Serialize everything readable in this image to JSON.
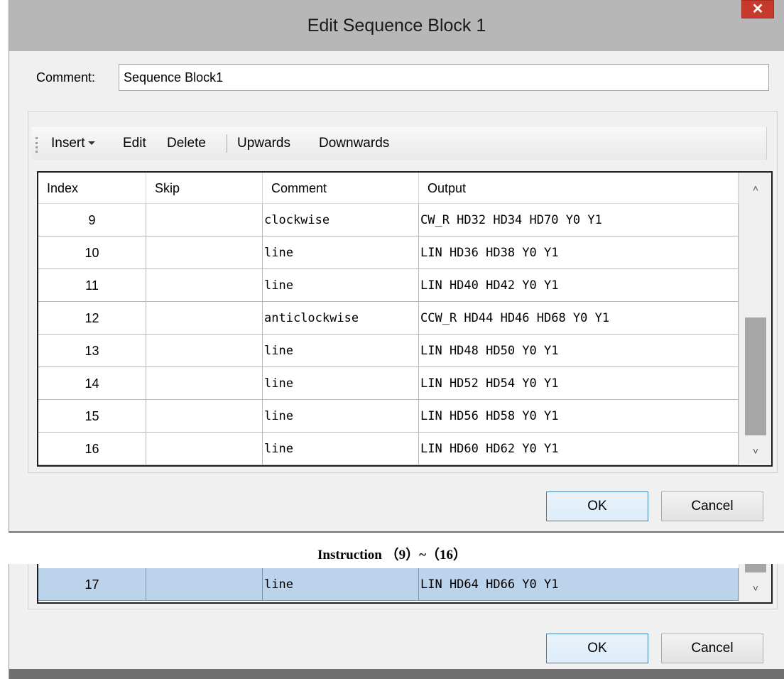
{
  "dialog": {
    "title": "Edit Sequence Block 1",
    "close_label": "✕",
    "comment_label": "Comment:",
    "comment_value": "Sequence Block1"
  },
  "toolbar": {
    "insert": "Insert",
    "edit": "Edit",
    "delete": "Delete",
    "upwards": "Upwards",
    "downwards": "Downwards"
  },
  "table": {
    "headers": [
      "Index",
      "Skip",
      "Comment",
      "Output"
    ],
    "rows": [
      {
        "index": "9",
        "skip": "",
        "comment": "clockwise",
        "output": "CW_R HD32 HD34 HD70 Y0 Y1"
      },
      {
        "index": "10",
        "skip": "",
        "comment": "line",
        "output": "LIN HD36 HD38 Y0 Y1"
      },
      {
        "index": "11",
        "skip": "",
        "comment": "line",
        "output": "LIN HD40 HD42 Y0 Y1"
      },
      {
        "index": "12",
        "skip": "",
        "comment": "anticlockwise",
        "output": "CCW_R HD44 HD46 HD68 Y0 Y1"
      },
      {
        "index": "13",
        "skip": "",
        "comment": "line",
        "output": "LIN HD48 HD50 Y0 Y1"
      },
      {
        "index": "14",
        "skip": "",
        "comment": "line",
        "output": "LIN HD52 HD54 Y0 Y1"
      },
      {
        "index": "15",
        "skip": "",
        "comment": "line",
        "output": "LIN HD56 HD58 Y0 Y1"
      },
      {
        "index": "16",
        "skip": "",
        "comment": "line",
        "output": "LIN HD60 HD62 Y0 Y1"
      }
    ]
  },
  "buttons": {
    "ok": "OK",
    "cancel": "Cancel"
  },
  "caption": "Instruction （9）~（16）",
  "second": {
    "row": {
      "index": "17",
      "skip": "",
      "comment": "line",
      "output": "LIN HD64 HD66 Y0 Y1"
    },
    "ok": "OK",
    "cancel": "Cancel"
  },
  "colors": {
    "titlebar": "#b7b7b7",
    "close": "#c7392c",
    "selected_row": "#bcd3ec",
    "default_button_border": "#3c7fb1"
  }
}
